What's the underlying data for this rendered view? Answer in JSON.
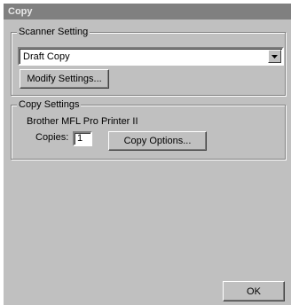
{
  "window": {
    "title": "Copy"
  },
  "scanner": {
    "group_label": "Scanner Setting",
    "selected_value": "Draft Copy",
    "modify_button": "Modify Settings..."
  },
  "copy": {
    "group_label": "Copy Settings",
    "printer_name": "Brother MFL Pro Printer II",
    "copies_label": "Copies:",
    "copies_value": "1",
    "options_button": "Copy Options..."
  },
  "footer": {
    "ok_button": "OK"
  }
}
